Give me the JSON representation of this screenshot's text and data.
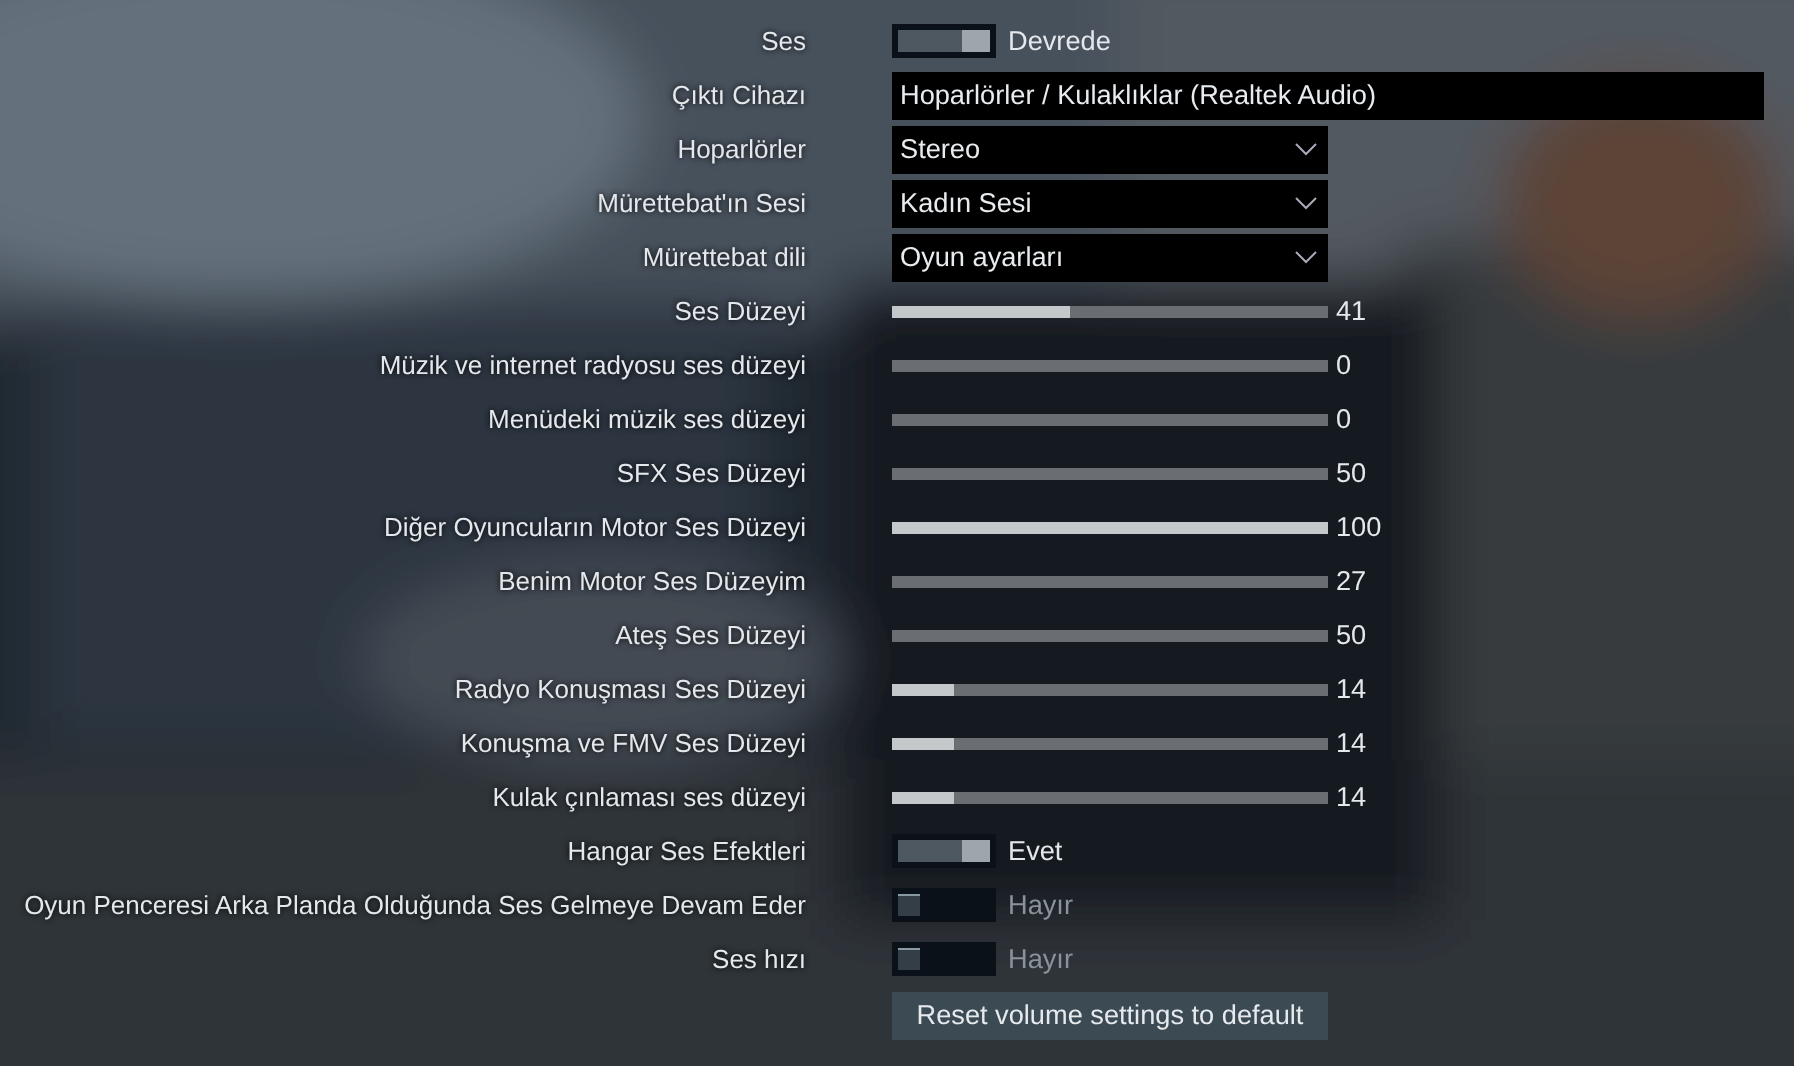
{
  "settings": [
    {
      "label": "Ses",
      "kind": "toggle",
      "on": true,
      "value": "Devrede"
    },
    {
      "label": "Çıktı Cihazı",
      "kind": "field",
      "value": "Hoparlörler / Kulaklıklar (Realtek Audio)"
    },
    {
      "label": "Hoparlörler",
      "kind": "dropdown",
      "value": "Stereo"
    },
    {
      "label": "Mürettebat'ın Sesi",
      "kind": "dropdown",
      "value": "Kadın Sesi"
    },
    {
      "label": "Mürettebat dili",
      "kind": "dropdown",
      "value": "Oyun ayarları"
    },
    {
      "label": "Ses Düzeyi",
      "kind": "slider",
      "level": 0.41,
      "reading": "41"
    },
    {
      "label": "Müzik ve internet radyosu ses düzeyi",
      "kind": "slider",
      "level": 0,
      "reading": "0"
    },
    {
      "label": "Menüdeki müzik ses düzeyi",
      "kind": "slider",
      "level": 0,
      "reading": "0"
    },
    {
      "label": "SFX Ses Düzeyi",
      "kind": "slider",
      "level": 0,
      "reading": "50"
    },
    {
      "label": "Diğer Oyuncuların Motor Ses Düzeyi",
      "kind": "slider",
      "level": 1,
      "reading": "100"
    },
    {
      "label": "Benim Motor Ses Düzeyim",
      "kind": "slider",
      "level": 0,
      "reading": "27"
    },
    {
      "label": "Ateş Ses Düzeyi",
      "kind": "slider",
      "level": 0,
      "reading": "50"
    },
    {
      "label": "Radyo Konuşması Ses Düzeyi",
      "kind": "slider",
      "level": 0.14,
      "reading": "14"
    },
    {
      "label": "Konuşma ve FMV Ses Düzeyi",
      "kind": "slider",
      "level": 0.14,
      "reading": "14"
    },
    {
      "label": "Kulak çınlaması ses düzeyi",
      "kind": "slider",
      "level": 0.14,
      "reading": "14"
    },
    {
      "label": "Hangar Ses Efektleri",
      "kind": "toggle",
      "on": true,
      "value": "Evet"
    },
    {
      "label": "Oyun Penceresi Arka Planda Olduğunda Ses Gelmeye Devam Eder",
      "kind": "toggle",
      "on": false,
      "value": "Hayır"
    },
    {
      "label": "Ses hızı",
      "kind": "toggle",
      "on": false,
      "value": "Hayır"
    }
  ],
  "reset_button": "Reset volume settings to default"
}
